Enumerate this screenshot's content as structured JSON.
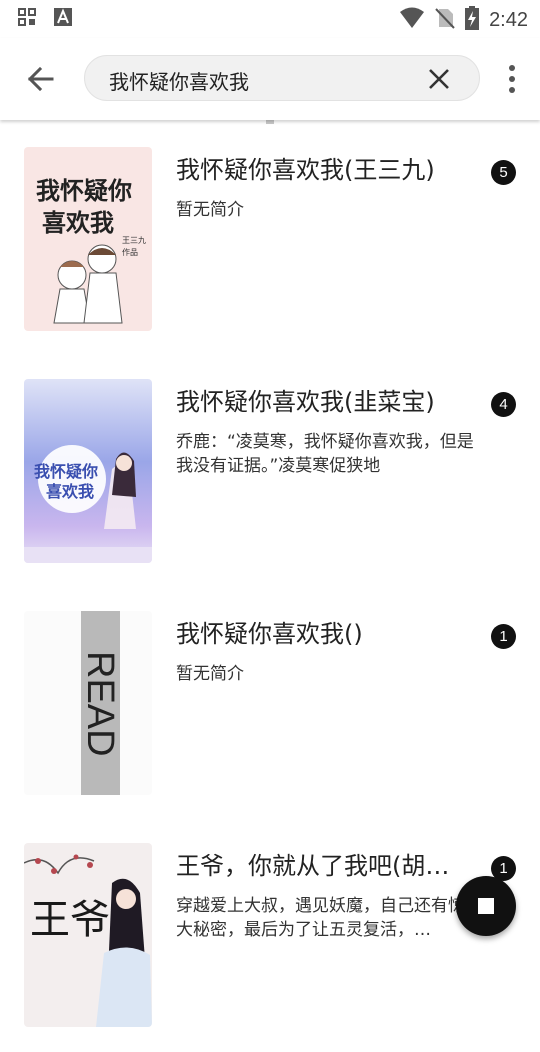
{
  "status_bar": {
    "time": "2:42",
    "icons": [
      "apps-icon",
      "a-box-icon",
      "wifi-icon",
      "no-sim-icon",
      "battery-charging-icon"
    ]
  },
  "toolbar": {
    "search_value": "我怀疑你喜欢我",
    "icons": [
      "back-arrow-icon",
      "clear-icon",
      "more-vert-icon"
    ]
  },
  "books": [
    {
      "title": "我怀疑你喜欢我(王三九)",
      "intro": "暂无简介",
      "badge": "5",
      "cover_text": [
        "我怀疑你",
        "喜欢我"
      ],
      "cover_author": "王三九",
      "cover_tag": "作品"
    },
    {
      "title": "我怀疑你喜欢我(韭菜宝)",
      "intro": "乔鹿：“凌莫寒，我怀疑你喜欢我，但是我没有证据。”凌莫寒促狭地",
      "badge": "4",
      "cover_text": [
        "我怀疑你",
        "喜欢我"
      ]
    },
    {
      "title": "我怀疑你喜欢我()",
      "intro": "暂无简介",
      "badge": "1",
      "cover_text": [
        "READ"
      ]
    },
    {
      "title": "王爷，你就从了我吧(胡胡…",
      "intro": "穿越爱上大叔，遇见妖魔，自己还有惊天大秘密，最后为了让五灵复活，…",
      "badge": "1",
      "cover_text": [
        "王爷"
      ]
    }
  ],
  "colors": {
    "accent": "#111111",
    "cover1_bg": "#f9e6e4",
    "cover2_bg": "#9aa6e8",
    "cover3_band": "#b9b9b9"
  }
}
